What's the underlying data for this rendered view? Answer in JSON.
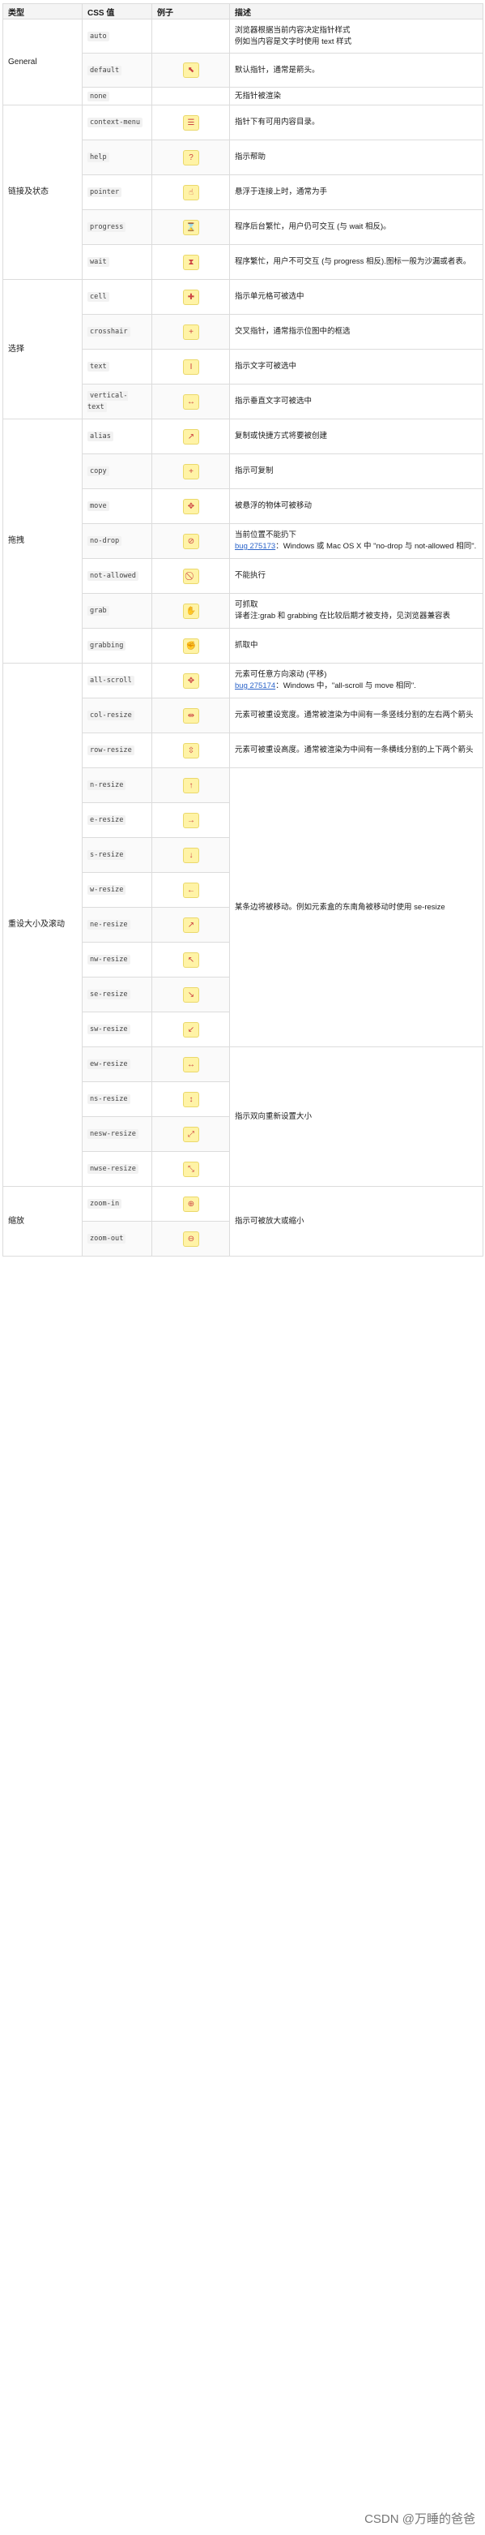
{
  "headers": [
    "类型",
    "CSS 值",
    "例子",
    "描述"
  ],
  "groups": [
    {
      "category": "General",
      "rows": [
        {
          "value": "auto",
          "icon": "",
          "icon_name": "",
          "desc": "浏览器根据当前内容决定指针样式\n例如当内容是文字时使用 text 样式"
        },
        {
          "value": "default",
          "icon": "⬉",
          "icon_name": "arrow-cursor-icon",
          "desc": "默认指针，通常是箭头。"
        },
        {
          "value": "none",
          "icon": "",
          "icon_name": "",
          "desc": "无指针被渲染"
        }
      ]
    },
    {
      "category": "链接及状态",
      "rows": [
        {
          "value": "context-menu",
          "icon": "☰",
          "icon_name": "context-menu-cursor-icon",
          "desc": "指针下有可用内容目录。"
        },
        {
          "value": "help",
          "icon": "?",
          "icon_name": "help-cursor-icon",
          "desc": "指示帮助"
        },
        {
          "value": "pointer",
          "icon": "☝",
          "icon_name": "hand-pointer-cursor-icon",
          "desc": "悬浮于连接上时，通常为手"
        },
        {
          "value": "progress",
          "icon": "⌛",
          "icon_name": "progress-cursor-icon",
          "desc": "程序后台繁忙，用户仍可交互 (与 wait 相反)。"
        },
        {
          "value": "wait",
          "icon": "⧗",
          "icon_name": "wait-cursor-icon",
          "desc": "程序繁忙，用户不可交互 (与 progress 相反).图标一般为沙漏或者表。"
        }
      ]
    },
    {
      "category": "选择",
      "rows": [
        {
          "value": "cell",
          "icon": "✚",
          "icon_name": "cell-cursor-icon",
          "desc": "指示单元格可被选中"
        },
        {
          "value": "crosshair",
          "icon": "+",
          "icon_name": "crosshair-cursor-icon",
          "desc": "交叉指针，通常指示位图中的框选"
        },
        {
          "value": "text",
          "icon": "I",
          "icon_name": "text-cursor-icon",
          "desc": "指示文字可被选中"
        },
        {
          "value": "vertical-text",
          "icon": "↔",
          "icon_name": "vertical-text-cursor-icon",
          "desc": "指示垂直文字可被选中"
        }
      ]
    },
    {
      "category": "拖拽",
      "rows": [
        {
          "value": "alias",
          "icon": "↗",
          "icon_name": "alias-cursor-icon",
          "desc": "复制或快捷方式将要被创建"
        },
        {
          "value": "copy",
          "icon": "+",
          "icon_name": "copy-cursor-icon",
          "desc": "指示可复制"
        },
        {
          "value": "move",
          "icon": "✥",
          "icon_name": "move-cursor-icon",
          "desc": "被悬浮的物体可被移动"
        },
        {
          "value": "no-drop",
          "icon": "⊘",
          "icon_name": "no-drop-cursor-icon",
          "desc": "当前位置不能扔下",
          "link": "bug 275173",
          "desc_after": "：Windows 或 Mac OS X 中 \"no-drop 与 not-allowed 相同\"."
        },
        {
          "value": "not-allowed",
          "icon": "⃠",
          "icon_name": "not-allowed-cursor-icon",
          "desc": "不能执行"
        },
        {
          "value": "grab",
          "icon": "✋",
          "icon_name": "grab-cursor-icon",
          "desc": "可抓取\n译者注:grab 和 grabbing 在比较后期才被支持，见浏览器兼容表"
        },
        {
          "value": "grabbing",
          "icon": "✊",
          "icon_name": "grabbing-cursor-icon",
          "desc": "抓取中"
        }
      ]
    },
    {
      "category": "重设大小及滚动",
      "rows": [
        {
          "value": "all-scroll",
          "icon": "✥",
          "icon_name": "all-scroll-cursor-icon",
          "desc": "元素可任意方向滚动 (平移)",
          "link": "bug 275174",
          "desc_after": "：Windows 中，\"all-scroll 与 move 相同\"."
        },
        {
          "value": "col-resize",
          "icon": "⇹",
          "icon_name": "col-resize-cursor-icon",
          "desc": "元素可被重设宽度。通常被渲染为中间有一条竖线分割的左右两个箭头"
        },
        {
          "value": "row-resize",
          "icon": "⇳",
          "icon_name": "row-resize-cursor-icon",
          "desc": "元素可被重设高度。通常被渲染为中间有一条横线分割的上下两个箭头"
        },
        {
          "value": "n-resize",
          "icon": "↑",
          "icon_name": "n-resize-cursor-icon",
          "desc": ""
        },
        {
          "value": "e-resize",
          "icon": "→",
          "icon_name": "e-resize-cursor-icon",
          "desc": ""
        },
        {
          "value": "s-resize",
          "icon": "↓",
          "icon_name": "s-resize-cursor-icon",
          "desc": ""
        },
        {
          "value": "w-resize",
          "icon": "←",
          "icon_name": "w-resize-cursor-icon",
          "desc": ""
        },
        {
          "value": "ne-resize",
          "icon": "↗",
          "icon_name": "ne-resize-cursor-icon",
          "desc": ""
        },
        {
          "value": "nw-resize",
          "icon": "↖",
          "icon_name": "nw-resize-cursor-icon",
          "desc": ""
        },
        {
          "value": "se-resize",
          "icon": "↘",
          "icon_name": "se-resize-cursor-icon",
          "desc": ""
        },
        {
          "value": "sw-resize",
          "icon": "↙",
          "icon_name": "sw-resize-cursor-icon",
          "desc": ""
        },
        {
          "value": "ew-resize",
          "icon": "↔",
          "icon_name": "ew-resize-cursor-icon",
          "desc": ""
        },
        {
          "value": "ns-resize",
          "icon": "↕",
          "icon_name": "ns-resize-cursor-icon",
          "desc": ""
        },
        {
          "value": "nesw-resize",
          "icon": "⤢",
          "icon_name": "nesw-resize-cursor-icon",
          "desc": ""
        },
        {
          "value": "nwse-resize",
          "icon": "⤡",
          "icon_name": "nwse-resize-cursor-icon",
          "desc": ""
        }
      ]
    },
    {
      "category": "缩放",
      "rows": [
        {
          "value": "zoom-in",
          "icon": "⊕",
          "icon_name": "zoom-in-cursor-icon",
          "desc": ""
        },
        {
          "value": "zoom-out",
          "icon": "⊖",
          "icon_name": "zoom-out-cursor-icon",
          "desc": ""
        }
      ]
    }
  ],
  "merged_notes": {
    "edge_resize": "某条边将被移动。例如元素盒的东南角被移动时使用 se-resize",
    "bidirectional": "指示双向重新设置大小",
    "zoom": "指示可被放大或缩小"
  },
  "watermark": "CSDN @万睡的爸爸"
}
